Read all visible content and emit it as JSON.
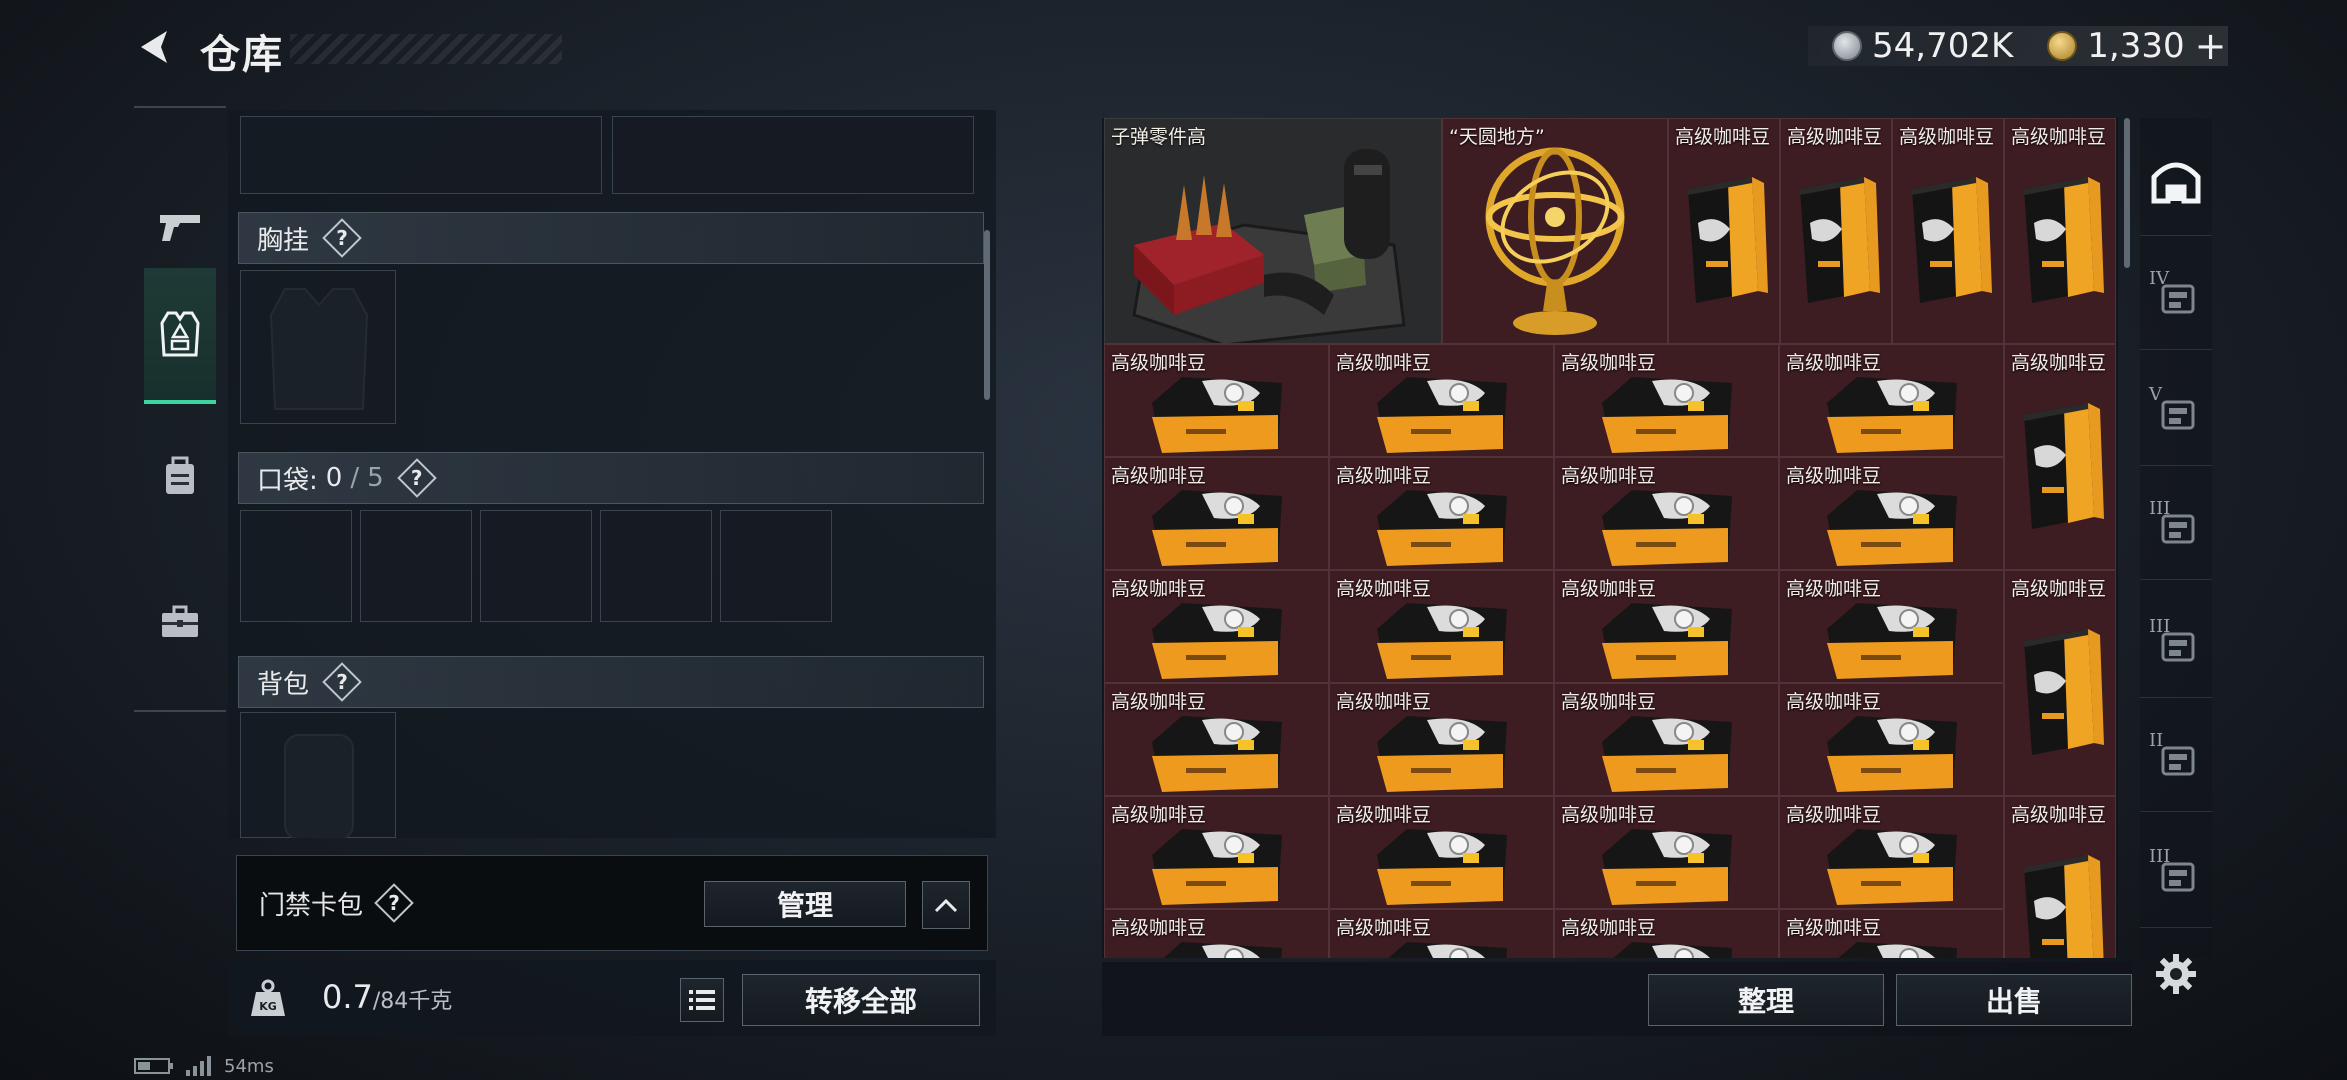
{
  "header": {
    "title": "仓库"
  },
  "currency": {
    "silver": "54,702K",
    "gold": "1,330",
    "add": "+"
  },
  "equipment": {
    "chest_rig": {
      "label": "胸挂",
      "help": "?"
    },
    "pockets": {
      "label": "口袋:",
      "count": "0",
      "sep": "/",
      "max": "5",
      "help": "?"
    },
    "backpack": {
      "label": "背包",
      "help": "?"
    },
    "keycard": {
      "label": "门禁卡包",
      "help": "?",
      "manage": "管理"
    }
  },
  "weight": {
    "current": "0.7",
    "max": "/84千克"
  },
  "actions": {
    "transfer_all": "转移全部",
    "organize": "整理",
    "sell": "出售"
  },
  "status": {
    "ping": "54ms"
  },
  "items": [
    {
      "label": "子弹零件高",
      "type": "ammo-parts",
      "bg": "gray"
    },
    {
      "label": "“天圆地方”",
      "type": "armillary",
      "bg": "red"
    },
    {
      "label": "高级咖啡豆",
      "type": "coffee-bag",
      "bg": "red"
    },
    {
      "label": "高级咖啡豆",
      "type": "coffee-bag",
      "bg": "red"
    },
    {
      "label": "高级咖啡豆",
      "type": "coffee-bag",
      "bg": "red"
    },
    {
      "label": "高级咖啡豆",
      "type": "coffee-bag",
      "bg": "red"
    },
    {
      "label": "高级咖啡豆",
      "type": "coffee-flat",
      "bg": "red"
    },
    {
      "label": "高级咖啡豆",
      "type": "coffee-flat",
      "bg": "red"
    },
    {
      "label": "高级咖啡豆",
      "type": "coffee-flat",
      "bg": "red"
    },
    {
      "label": "高级咖啡豆",
      "type": "coffee-flat",
      "bg": "red"
    },
    {
      "label": "高级咖啡豆",
      "type": "coffee-bag",
      "bg": "red"
    },
    {
      "label": "高级咖啡豆",
      "type": "coffee-flat",
      "bg": "red"
    },
    {
      "label": "高级咖啡豆",
      "type": "coffee-flat",
      "bg": "red"
    },
    {
      "label": "高级咖啡豆",
      "type": "coffee-flat",
      "bg": "red"
    },
    {
      "label": "高级咖啡豆",
      "type": "coffee-flat",
      "bg": "red"
    },
    {
      "label": "高级咖啡豆",
      "type": "coffee-flat",
      "bg": "red"
    },
    {
      "label": "高级咖啡豆",
      "type": "coffee-flat",
      "bg": "red"
    },
    {
      "label": "高级咖啡豆",
      "type": "coffee-flat",
      "bg": "red"
    },
    {
      "label": "高级咖啡豆",
      "type": "coffee-flat",
      "bg": "red"
    },
    {
      "label": "高级咖啡豆",
      "type": "coffee-bag",
      "bg": "red"
    },
    {
      "label": "高级咖啡豆",
      "type": "coffee-flat",
      "bg": "red"
    },
    {
      "label": "高级咖啡豆",
      "type": "coffee-flat",
      "bg": "red"
    },
    {
      "label": "高级咖啡豆",
      "type": "coffee-flat",
      "bg": "red"
    },
    {
      "label": "高级咖啡豆",
      "type": "coffee-flat",
      "bg": "red"
    },
    {
      "label": "高级咖啡豆",
      "type": "coffee-flat",
      "bg": "red"
    },
    {
      "label": "高级咖啡豆",
      "type": "coffee-flat",
      "bg": "red"
    },
    {
      "label": "高级咖啡豆",
      "type": "coffee-flat",
      "bg": "red"
    },
    {
      "label": "高级咖啡豆",
      "type": "coffee-flat",
      "bg": "red"
    },
    {
      "label": "高级咖啡豆",
      "type": "coffee-bag",
      "bg": "red"
    },
    {
      "label": "高级咖啡豆",
      "type": "coffee-flat",
      "bg": "red"
    },
    {
      "label": "高级咖啡豆",
      "type": "coffee-flat",
      "bg": "red"
    },
    {
      "label": "高级咖啡豆",
      "type": "coffee-flat",
      "bg": "red"
    },
    {
      "label": "高级咖啡豆",
      "type": "coffee-flat",
      "bg": "red"
    }
  ],
  "filters": [
    {
      "name": "all-items"
    },
    {
      "tier": "IV",
      "name": "tier-4-filter"
    },
    {
      "tier": "V",
      "name": "tier-5-filter"
    },
    {
      "tier": "III",
      "name": "tier-3-filter-a"
    },
    {
      "tier": "III",
      "name": "tier-3-filter-b"
    },
    {
      "tier": "II",
      "name": "tier-2-filter"
    },
    {
      "tier": "III",
      "name": "tier-3-filter-c"
    }
  ],
  "colors": {
    "accent": "#3ed3a1",
    "item_red": "#3d1c22",
    "item_gray": "#2a2b2c",
    "coffee_gold": "#e8a020"
  }
}
